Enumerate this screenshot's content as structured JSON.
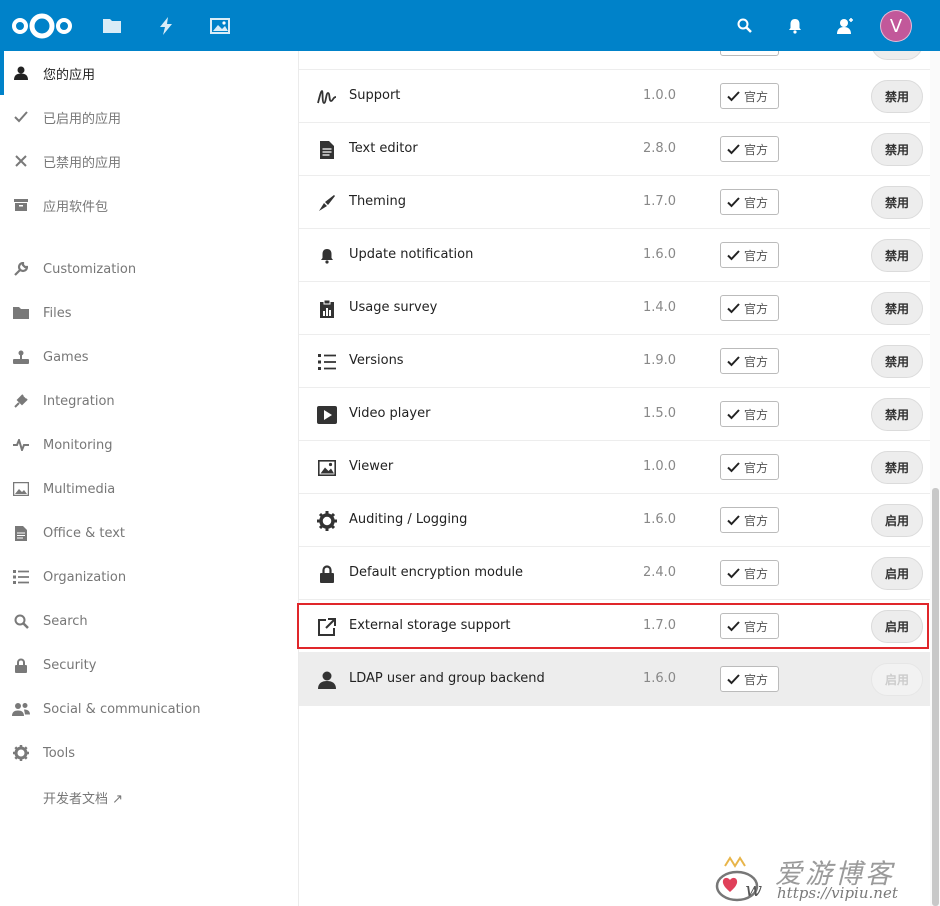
{
  "header": {
    "avatar_letter": "V",
    "brand_color": "#0082c9",
    "avatar_color": "#c2589a",
    "icons": [
      "nextcloud-logo",
      "files-icon",
      "activity-icon",
      "gallery-icon",
      "search-icon",
      "notifications-icon",
      "contacts-icon"
    ]
  },
  "sidebar": {
    "items": [
      {
        "label": "您的应用",
        "icon": "user-icon"
      },
      {
        "label": "已启用的应用",
        "icon": "check-icon"
      },
      {
        "label": "已禁用的应用",
        "icon": "close-icon"
      },
      {
        "label": "应用软件包",
        "icon": "archive-icon"
      },
      {
        "label": "Customization",
        "icon": "wrench-icon"
      },
      {
        "label": "Files",
        "icon": "folder-icon"
      },
      {
        "label": "Games",
        "icon": "joystick-icon"
      },
      {
        "label": "Integration",
        "icon": "plug-icon"
      },
      {
        "label": "Monitoring",
        "icon": "pulse-icon"
      },
      {
        "label": "Multimedia",
        "icon": "image-icon"
      },
      {
        "label": "Office & text",
        "icon": "document-icon"
      },
      {
        "label": "Organization",
        "icon": "list-icon"
      },
      {
        "label": "Search",
        "icon": "search-icon"
      },
      {
        "label": "Security",
        "icon": "lock-icon"
      },
      {
        "label": "Social & communication",
        "icon": "people-icon"
      },
      {
        "label": "Tools",
        "icon": "gear-icon"
      },
      {
        "label": "开发者文档 ↗",
        "icon": ""
      }
    ]
  },
  "apps": {
    "badge_label": "官方",
    "rows": [
      {
        "name": "Support",
        "version": "1.0.0",
        "button": "禁用",
        "icon": "signature-icon"
      },
      {
        "name": "Text editor",
        "version": "2.8.0",
        "button": "禁用",
        "icon": "text-document-icon"
      },
      {
        "name": "Theming",
        "version": "1.7.0",
        "button": "禁用",
        "icon": "paintbrush-icon"
      },
      {
        "name": "Update notification",
        "version": "1.6.0",
        "button": "禁用",
        "icon": "bell-icon"
      },
      {
        "name": "Usage survey",
        "version": "1.4.0",
        "button": "禁用",
        "icon": "clipboard-chart-icon"
      },
      {
        "name": "Versions",
        "version": "1.9.0",
        "button": "禁用",
        "icon": "versions-list-icon"
      },
      {
        "name": "Video player",
        "version": "1.5.0",
        "button": "禁用",
        "icon": "play-icon"
      },
      {
        "name": "Viewer",
        "version": "1.0.0",
        "button": "禁用",
        "icon": "picture-icon"
      },
      {
        "name": "Auditing / Logging",
        "version": "1.6.0",
        "button": "启用",
        "icon": "gear-icon"
      },
      {
        "name": "Default encryption module",
        "version": "2.4.0",
        "button": "启用",
        "icon": "lock-icon"
      },
      {
        "name": "External storage support",
        "version": "1.7.0",
        "button": "启用",
        "icon": "external-link-icon"
      },
      {
        "name": "LDAP user and group backend",
        "version": "1.6.0",
        "button": "启用",
        "icon": "user-icon"
      }
    ]
  },
  "watermark": {
    "cn": "爱游博客",
    "url": "https://vipiu.net"
  }
}
